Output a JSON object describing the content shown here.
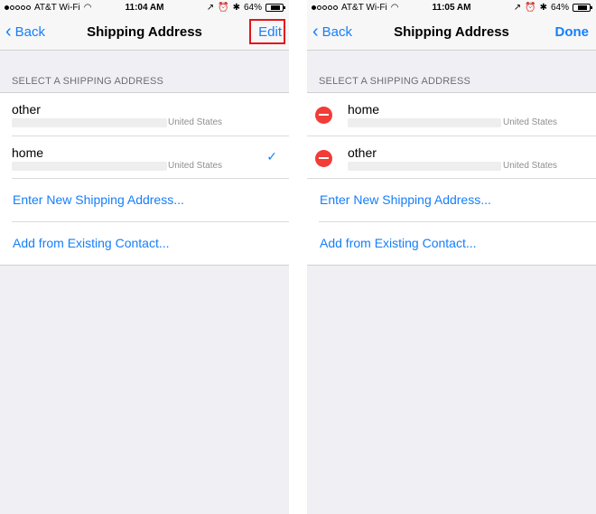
{
  "left": {
    "status": {
      "carrier": "AT&T Wi-Fi",
      "time": "11:04 AM",
      "battery": "64%",
      "battery_level": 0.64
    },
    "nav": {
      "back": "Back",
      "title": "Shipping Address",
      "action": "Edit"
    },
    "section_header": "SELECT A SHIPPING ADDRESS",
    "addresses": [
      {
        "name": "other",
        "country": "United States",
        "selected": false
      },
      {
        "name": "home",
        "country": "United States",
        "selected": true
      }
    ],
    "links": [
      "Enter New Shipping Address...",
      "Add from Existing Contact..."
    ]
  },
  "right": {
    "status": {
      "carrier": "AT&T Wi-Fi",
      "time": "11:05 AM",
      "battery": "64%",
      "battery_level": 0.64
    },
    "nav": {
      "back": "Back",
      "title": "Shipping Address",
      "action": "Done"
    },
    "section_header": "SELECT A SHIPPING ADDRESS",
    "addresses": [
      {
        "name": "home",
        "country": "United States"
      },
      {
        "name": "other",
        "country": "United States"
      }
    ],
    "links": [
      "Enter New Shipping Address...",
      "Add from Existing Contact..."
    ]
  },
  "icons": {
    "back": "chevron-left-icon",
    "wifi": "wifi-icon",
    "location": "location-arrow-icon",
    "alarm": "alarm-clock-icon",
    "bluetooth": "bluetooth-icon",
    "battery": "battery-icon",
    "check": "checkmark-icon",
    "delete": "delete-minus-icon"
  },
  "colors": {
    "tint": "#157efb",
    "delete": "#f23c36",
    "highlight": "#e3151a",
    "background": "#efeff4"
  }
}
